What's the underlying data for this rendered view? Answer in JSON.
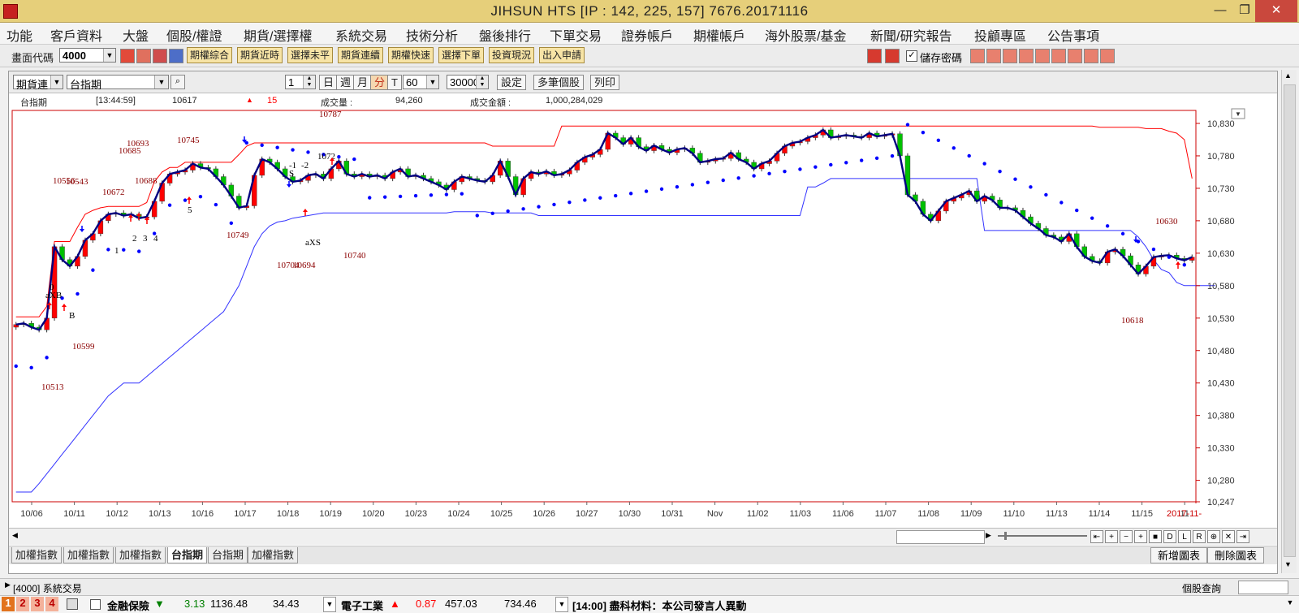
{
  "window": {
    "title": "JIHSUN HTS      [IP : 142, 225, 157] 7676.20171116"
  },
  "menu": [
    "功能",
    "客戶資料",
    "大盤",
    "個股/權證",
    "期貨/選擇權",
    "系統交易",
    "技術分析",
    "盤後排行",
    "下單交易",
    "證券帳戶",
    "期權帳戶",
    "海外股票/基金",
    "新聞/研究報告",
    "投顧專區",
    "公告事項"
  ],
  "toolbar": {
    "screen_code_label": "畫面代碼",
    "screen_code_value": "4000",
    "buttons": [
      "期權綜合",
      "期貨近時",
      "選擇未平",
      "期貨連續",
      "期權快速",
      "選擇下單",
      "投資現況",
      "出入申請"
    ],
    "save_password_label": "儲存密碼",
    "save_password_checked": true
  },
  "chart_controls": {
    "contract_select": "期貨連",
    "symbol_select": "台指期",
    "spinner_value": "1",
    "period_buttons": [
      "日",
      "週",
      "月",
      "分",
      "T"
    ],
    "selected_period": "分",
    "interval_value": "60",
    "bars_value": "30000",
    "action_buttons": [
      "設定",
      "多筆個股",
      "列印"
    ]
  },
  "quote_info": {
    "name": "台指期",
    "time": "[13:44:59]",
    "price": "10617",
    "change_arrow": "▲",
    "change": "15",
    "volume_label": "成交量  :",
    "volume": "94,260",
    "amount_label": "成交金額  :",
    "amount": "1,000,284,029"
  },
  "chart_data": {
    "type": "line",
    "title": "",
    "ylim": [
      10247,
      10850
    ],
    "y_ticks": [
      "10,830",
      "10,780",
      "10,730",
      "10,680",
      "10,630",
      "10,580",
      "10,530",
      "10,480",
      "10,430",
      "10,380",
      "10,330",
      "10,280",
      "10,247"
    ],
    "y_tick_values": [
      10830,
      10780,
      10730,
      10680,
      10630,
      10580,
      10530,
      10480,
      10430,
      10380,
      10330,
      10280,
      10247
    ],
    "x_labels": [
      "10/06",
      "10/11",
      "10/12",
      "10/13",
      "10/16",
      "10/17",
      "10/18",
      "10/19",
      "10/20",
      "10/23",
      "10/24",
      "10/25",
      "10/26",
      "10/27",
      "10/30",
      "10/31",
      "Nov",
      "11/02",
      "11/03",
      "11/06",
      "11/07",
      "11/08",
      "11/09",
      "11/10",
      "11/13",
      "11/14",
      "11/15",
      "11"
    ],
    "last_x_label": "2017-11-",
    "series": [
      {
        "name": "",
        "color": "#000080",
        "values": [
          10520,
          10522,
          10516,
          10512,
          10530,
          10640,
          10620,
          10610,
          10625,
          10650,
          10660,
          10680,
          10690,
          10692,
          10688,
          10690,
          10684,
          10686,
          10710,
          10738,
          10752,
          10755,
          10758,
          10768,
          10762,
          10760,
          10748,
          10735,
          10718,
          10700,
          10703,
          10750,
          10775,
          10770,
          10760,
          10748,
          10740,
          10742,
          10750,
          10752,
          10745,
          10760,
          10772,
          10752,
          10748,
          10752,
          10748,
          10750,
          10745,
          10755,
          10760,
          10748,
          10750,
          10745,
          10740,
          10735,
          10728,
          10740,
          10748,
          10745,
          10742,
          10740,
          10750,
          10772,
          10748,
          10720,
          10745,
          10755,
          10752,
          10756,
          10750,
          10752,
          10758,
          10770,
          10778,
          10782,
          10790,
          10815,
          10808,
          10798,
          10808,
          10794,
          10788,
          10796,
          10790,
          10785,
          10790,
          10792,
          10784,
          10770,
          10772,
          10775,
          10776,
          10785,
          10775,
          10770,
          10760,
          10768,
          10772,
          10784,
          10795,
          10800,
          10802,
          10808,
          10812,
          10820,
          10808,
          10810,
          10812,
          10810,
          10808,
          10815,
          10810,
          10812,
          10814,
          10780,
          10720,
          10710,
          10690,
          10680,
          10695,
          10710,
          10715,
          10720,
          10726,
          10710,
          10718,
          10712,
          10700,
          10700,
          10696,
          10686,
          10676,
          10668,
          10658,
          10655,
          10648,
          10660,
          10640,
          10625,
          10618,
          10615,
          10632,
          10636,
          10626,
          10612,
          10598,
          10610,
          10624,
          10626,
          10627,
          10622,
          10619,
          10624
        ]
      },
      {
        "name": "",
        "color": "#ff0000",
        "values": [
          10532,
          10532,
          10532,
          10532,
          10548,
          10648,
          10648,
          10648,
          10670,
          10690,
          10696,
          10700,
          10702,
          10702,
          10702,
          10702,
          10702,
          10708,
          10740,
          10755,
          10762,
          10762,
          10770,
          10770,
          10770,
          10770,
          10770,
          10770,
          10770,
          10782,
          10795,
          10800,
          10800,
          10800,
          10800,
          10800,
          10800,
          10800,
          10800,
          10800,
          10800,
          10800,
          10800,
          10800,
          10800,
          10800,
          10800,
          10800,
          10800,
          10800,
          10800,
          10800,
          10800,
          10800,
          10800,
          10800,
          10800,
          10800,
          10800,
          10800,
          10800,
          10800,
          10795,
          10795,
          10795,
          10795,
          10795,
          10795,
          10795,
          10795,
          10795,
          10826,
          10826,
          10826,
          10826,
          10826,
          10826,
          10826,
          10826,
          10826,
          10826,
          10826,
          10826,
          10826,
          10826,
          10826,
          10826,
          10826,
          10826,
          10826,
          10826,
          10826,
          10826,
          10826,
          10826,
          10826,
          10826,
          10826,
          10826,
          10826,
          10826,
          10826,
          10826,
          10826,
          10826,
          10826,
          10826,
          10826,
          10826,
          10826,
          10826,
          10826,
          10826,
          10826,
          10826,
          10826,
          10826,
          10826,
          10826,
          10826,
          10826,
          10826,
          10826,
          10826,
          10826,
          10826,
          10826,
          10826,
          10826,
          10826,
          10826,
          10826,
          10826,
          10826,
          10826,
          10826,
          10826,
          10826,
          10826,
          10826,
          10826,
          10824,
          10824,
          10824,
          10824,
          10824,
          10824,
          10822,
          10822,
          10822,
          10818,
          10815,
          10805,
          10745
        ]
      },
      {
        "name": "",
        "color": "#3333ff",
        "values": [
          10262,
          10262,
          10262,
          10275,
          10290,
          10305,
          10320,
          10335,
          10350,
          10365,
          10380,
          10395,
          10410,
          10420,
          10430,
          10430,
          10430,
          10440,
          10450,
          10460,
          10470,
          10480,
          10490,
          10500,
          10510,
          10520,
          10530,
          10540,
          10560,
          10580,
          10610,
          10640,
          10660,
          10672,
          10678,
          10680,
          10684,
          10686,
          10688,
          10690,
          10692,
          10692,
          10692,
          10692,
          10692,
          10692,
          10692,
          10692,
          10692,
          10692,
          10692,
          10692,
          10692,
          10692,
          10692,
          10692,
          10692,
          10694,
          10694,
          10694,
          10694,
          10694,
          10692,
          10692,
          10692,
          10692,
          10692,
          10692,
          10688,
          10688,
          10688,
          10688,
          10688,
          10688,
          10688,
          10688,
          10688,
          10688,
          10688,
          10688,
          10688,
          10688,
          10688,
          10688,
          10688,
          10688,
          10688,
          10688,
          10688,
          10688,
          10688,
          10688,
          10688,
          10688,
          10688,
          10688,
          10688,
          10688,
          10688,
          10688,
          10688,
          10688,
          10688,
          10732,
          10732,
          10738,
          10745,
          10745,
          10745,
          10745,
          10745,
          10745,
          10745,
          10745,
          10745,
          10745,
          10745,
          10745,
          10745,
          10745,
          10745,
          10745,
          10745,
          10745,
          10745,
          10745,
          10665,
          10665,
          10665,
          10665,
          10665,
          10665,
          10665,
          10665,
          10665,
          10665,
          10665,
          10665,
          10665,
          10665,
          10665,
          10665,
          10665,
          10665,
          10665,
          10665,
          10655,
          10640,
          10620,
          10605,
          10600,
          10585,
          10580,
          10580,
          10580,
          10580,
          10580
        ]
      }
    ],
    "annotations": [
      "10513",
      "10599",
      "10556",
      "10543",
      "10672",
      "10685",
      "10693",
      "10688",
      "10745",
      "10749",
      "10704",
      "10694",
      "10787",
      "10740",
      "10630",
      "10618",
      "aXB",
      "aXS",
      "B",
      "S",
      "1",
      "2",
      "3",
      "4",
      "5",
      "0",
      "-1",
      "-2",
      "1072"
    ]
  },
  "scroll_nav": [
    "⇤",
    "+",
    "−",
    "+",
    "■",
    "D",
    "L",
    "R",
    "⊕",
    "✕",
    "⇥"
  ],
  "tabs": [
    "加權指數",
    "加權指數",
    "加權指數",
    "台指期",
    "台指期",
    "加權指數"
  ],
  "active_tab": 3,
  "chart_buttons": [
    "新增圖表",
    "刪除圖表"
  ],
  "status": {
    "screen": "[4000] 系統交易",
    "right": "個股查詢"
  },
  "ticker": {
    "nums": [
      "1",
      "2",
      "3",
      "4"
    ],
    "item1_name": "金融保險",
    "item1_arrow": "▼",
    "item1_change": "3.13",
    "item1_index": "1136.48",
    "item1_amount": "34.43",
    "item2_name": "電子工業",
    "item2_arrow": "▲",
    "item2_change": "0.87",
    "item2_index": "457.03",
    "item2_amount": "734.46",
    "news": "[14:00]  盡科材料：本公司發言人異動"
  },
  "colors": {
    "up": "#ff0000",
    "down": "#00c000",
    "dots": "#0000ff",
    "ma": "#000080",
    "upper": "#ff0000",
    "lower": "#3333ff",
    "axis": "#cc0000"
  }
}
